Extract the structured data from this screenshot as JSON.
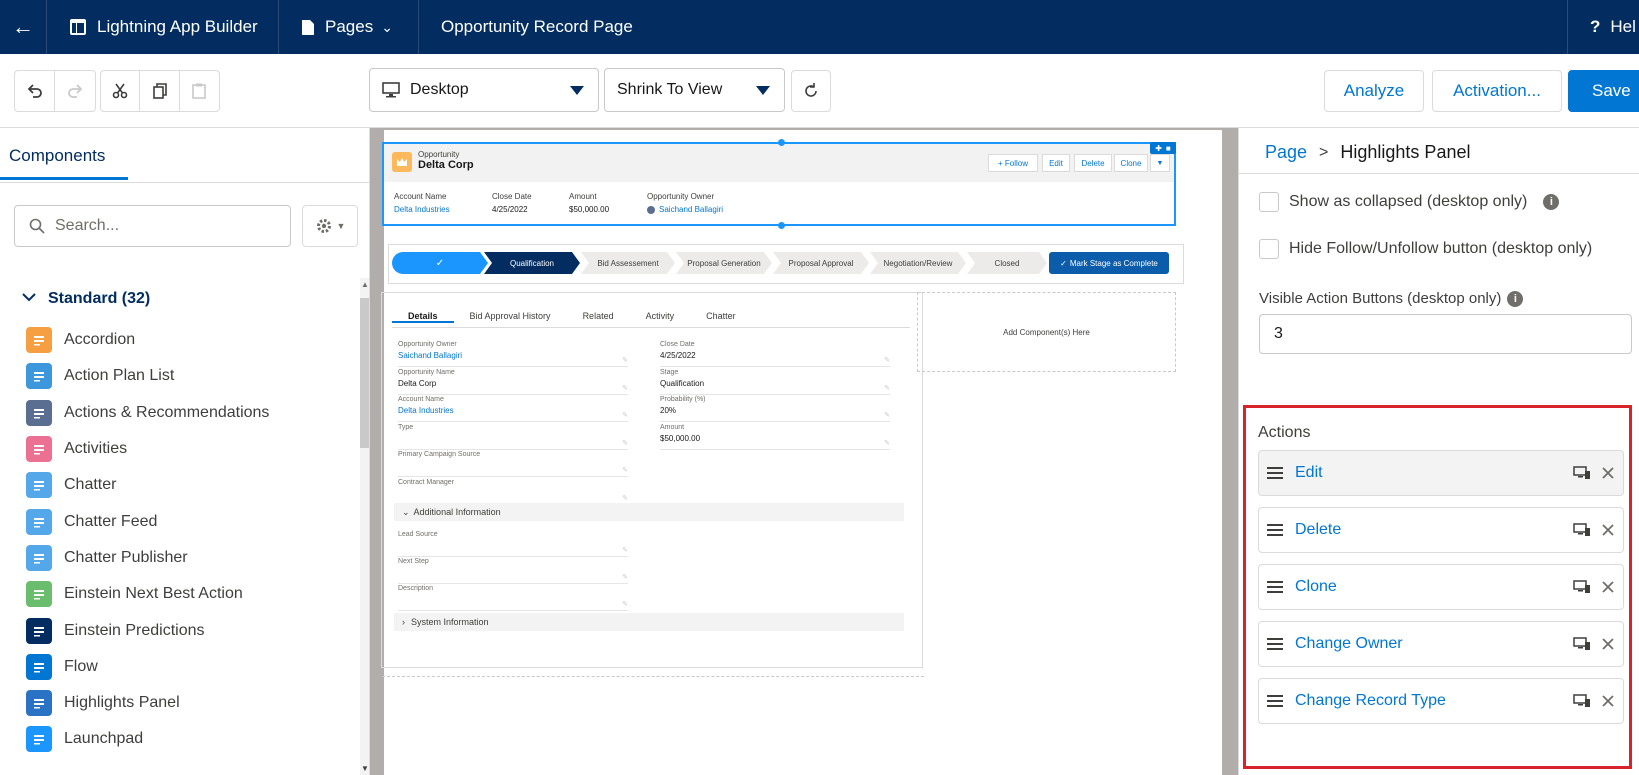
{
  "topbar": {
    "app_title": "Lightning App Builder",
    "pages_label": "Pages",
    "page_name": "Opportunity Record Page",
    "help_label": "Hel"
  },
  "toolbar": {
    "device": "Desktop",
    "view_mode": "Shrink To View",
    "analyze": "Analyze",
    "activation": "Activation...",
    "save": "Save"
  },
  "left": {
    "tab": "Components",
    "search_placeholder": "Search...",
    "standard_header": "Standard (32)",
    "components": [
      {
        "label": "Accordion",
        "color": "#f59e42"
      },
      {
        "label": "Action Plan List",
        "color": "#3c97dd"
      },
      {
        "label": "Actions & Recommendations",
        "color": "#5a6e91"
      },
      {
        "label": "Activities",
        "color": "#eb7092"
      },
      {
        "label": "Chatter",
        "color": "#54a7e8"
      },
      {
        "label": "Chatter Feed",
        "color": "#54a7e8"
      },
      {
        "label": "Chatter Publisher",
        "color": "#54a7e8"
      },
      {
        "label": "Einstein Next Best Action",
        "color": "#6bbd6e"
      },
      {
        "label": "Einstein Predictions",
        "color": "#032d60"
      },
      {
        "label": "Flow",
        "color": "#0176d3"
      },
      {
        "label": "Highlights Panel",
        "color": "#2a73c4"
      },
      {
        "label": "Launchpad",
        "color": "#1b96ff"
      }
    ]
  },
  "canvas": {
    "record": {
      "object": "Opportunity",
      "name": "Delta Corp",
      "buttons": [
        "+ Follow",
        "Edit",
        "Delete",
        "Clone"
      ],
      "fields": [
        {
          "label": "Account Name",
          "value": "Delta Industries"
        },
        {
          "label": "Close Date",
          "value": "4/25/2022"
        },
        {
          "label": "Amount",
          "value": "$50,000.00"
        },
        {
          "label": "Opportunity Owner",
          "value": "Saichand Ballagiri"
        }
      ]
    },
    "path": {
      "steps": [
        "Qualification",
        "Bid Assessement",
        "Proposal Generation",
        "Proposal Approval",
        "Negotiation/Review",
        "Closed"
      ],
      "mark_button": "Mark Stage as Complete"
    },
    "tabs": [
      "Details",
      "Bid Approval History",
      "Related",
      "Activity",
      "Chatter"
    ],
    "left_fields": [
      {
        "label": "Opportunity Owner",
        "value": "Saichand Ballagiri"
      },
      {
        "label": "Opportunity Name",
        "value": "Delta Corp"
      },
      {
        "label": "Account Name",
        "value": "Delta Industries"
      },
      {
        "label": "Type",
        "value": ""
      },
      {
        "label": "Primary Campaign Source",
        "value": ""
      },
      {
        "label": "Contract Manager",
        "value": ""
      }
    ],
    "right_fields": [
      {
        "label": "Close Date",
        "value": "4/25/2022"
      },
      {
        "label": "Stage",
        "value": "Qualification"
      },
      {
        "label": "Probability (%)",
        "value": "20%"
      },
      {
        "label": "Amount",
        "value": "$50,000.00"
      }
    ],
    "additional_section": "Additional Information",
    "additional_fields": [
      {
        "label": "Lead Source"
      },
      {
        "label": "Next Step"
      },
      {
        "label": "Description"
      }
    ],
    "system_section": "System Information",
    "add_component": "Add Component(s) Here"
  },
  "right": {
    "breadcrumb_page": "Page",
    "breadcrumb_sep": ">",
    "breadcrumb_current": "Highlights Panel",
    "opt_collapsed": "Show as collapsed (desktop only)",
    "opt_hide_follow": "Hide Follow/Unfollow button (desktop only)",
    "visible_buttons_label": "Visible Action Buttons (desktop only)",
    "visible_buttons_value": "3",
    "actions_title": "Actions",
    "actions": [
      "Edit",
      "Delete",
      "Clone",
      "Change Owner",
      "Change Record Type"
    ]
  }
}
